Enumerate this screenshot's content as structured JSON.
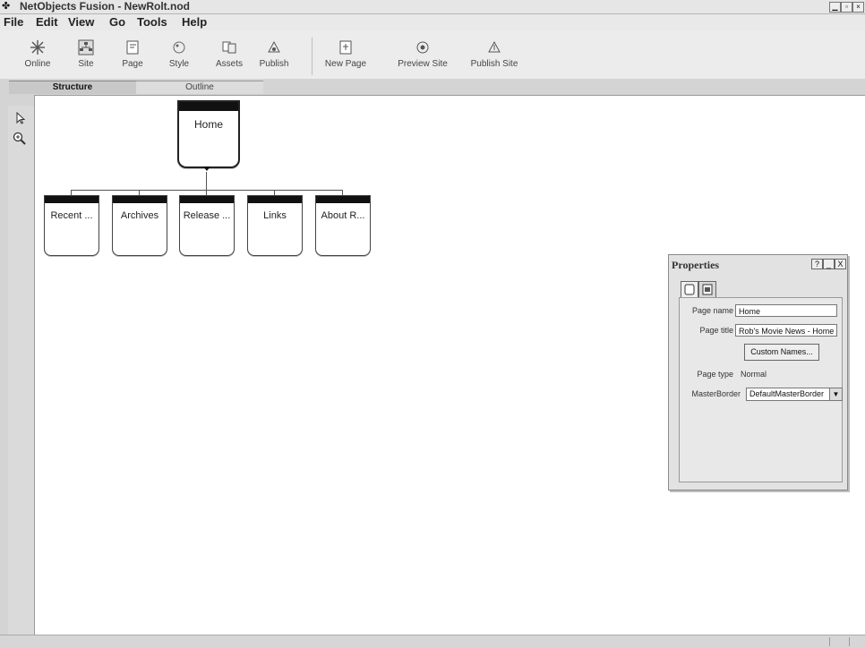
{
  "window": {
    "title": "NetObjects Fusion - NewRolt.nod",
    "app_icon": "fusion-app-icon",
    "controls": [
      "minimize-icon",
      "maximize-icon",
      "close-icon"
    ]
  },
  "menu": [
    "File",
    "Edit",
    "View",
    "Go",
    "Tools",
    "Help"
  ],
  "toolbar": {
    "buttons": [
      {
        "label": "Online",
        "icon": "online-icon"
      },
      {
        "label": "Site",
        "icon": "site-icon"
      },
      {
        "label": "Page",
        "icon": "page-icon"
      },
      {
        "label": "Style",
        "icon": "style-icon"
      },
      {
        "label": "Assets",
        "icon": "assets-icon"
      },
      {
        "label": "Publish",
        "icon": "publish-icon"
      },
      {
        "label": "New Page",
        "icon": "new-page-icon"
      },
      {
        "label": "Preview Site",
        "icon": "preview-site-icon"
      },
      {
        "label": "Publish Site",
        "icon": "publish-site-icon"
      }
    ]
  },
  "view_tabs": {
    "active": "Structure",
    "inactive": "Outline"
  },
  "tools": [
    "pointer-tool-icon",
    "zoom-tool-icon"
  ],
  "site_tree": {
    "root": "Home",
    "children": [
      "Recent ...",
      "Archives",
      "Release ...",
      "Links",
      "About R..."
    ]
  },
  "properties": {
    "title": "Properties",
    "title_buttons": [
      "?",
      "_",
      "X"
    ],
    "tabs": [
      "page-tab-icon",
      "properties-tab-icon"
    ],
    "page_name_label": "Page name",
    "page_name_value": "Home",
    "page_title_label": "Page title",
    "page_title_value": "Rob's Movie News - Home",
    "custom_names_button": "Custom Names...",
    "page_type_label": "Page type",
    "page_type_value": "Normal",
    "master_border_label": "MasterBorder",
    "master_border_value": "DefaultMasterBorder"
  },
  "colors": {
    "canvas": "#ffffff",
    "chrome": "#d4d4d4",
    "node_bar": "#111111"
  }
}
